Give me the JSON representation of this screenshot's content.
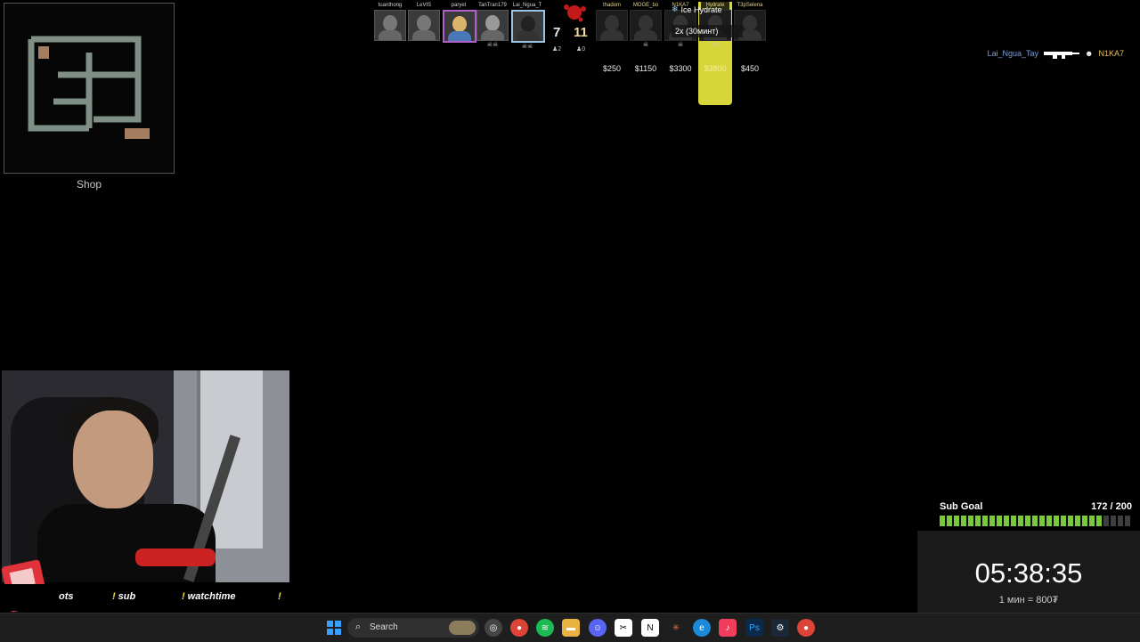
{
  "minimap": {
    "shop_label": "Shop"
  },
  "scoreboard": {
    "t_players": [
      {
        "name": "tuanthong",
        "skulls": ""
      },
      {
        "name": "LeVIS",
        "skulls": ""
      },
      {
        "name": "paryet",
        "skulls": ""
      },
      {
        "name": "TanTran179",
        "skulls": "☠☠"
      },
      {
        "name": "Lai_Ngua_T",
        "skulls": "☠☠"
      }
    ],
    "ct_players": [
      {
        "name": "thadom",
        "skulls": "",
        "money": "$250"
      },
      {
        "name": "MOGE_bo",
        "skulls": "☠",
        "money": "$1150"
      },
      {
        "name": "N1KA7",
        "skulls": "☠",
        "money": "$3300"
      },
      {
        "name": "Hydrate",
        "skulls": "☠",
        "money": "$3800"
      },
      {
        "name": "T3pSelena",
        "skulls": "",
        "money": "$450"
      }
    ],
    "t_score": "7",
    "ct_score": "11",
    "t_alive": "♟2",
    "ct_alive": "♟0"
  },
  "notification": {
    "title": "Ice Hydrate",
    "subtitle": "2x (30минт)"
  },
  "killfeed": {
    "attacker": "Lai_Ngua_Tay",
    "victim": "N1KA7"
  },
  "commands": [
    "ots",
    "sub",
    "watchtime"
  ],
  "sub_goal": {
    "label": "Sub Goal",
    "count": "172 / 200",
    "progress": 0.86
  },
  "timer": {
    "time": "05:38:35",
    "rate": "1 мин = 800₮"
  },
  "taskbar": {
    "search_placeholder": "Search"
  },
  "colors": {
    "accent_yellow": "#e7e13a",
    "goal_green": "#78c83a",
    "ct_gold": "#f0d99a"
  }
}
